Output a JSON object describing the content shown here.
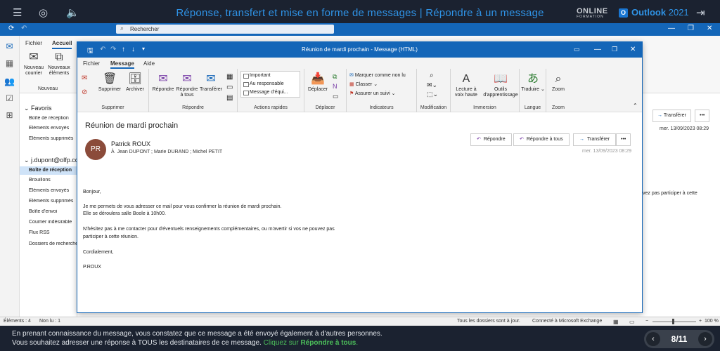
{
  "course": {
    "title": "Réponse, transfert et mise en forme de messages | Répondre à un message",
    "brand_online": "ONLINE",
    "brand_online_sub": "FORMATION",
    "brand_name": "Outlook",
    "brand_version": "2021"
  },
  "outlook": {
    "search_placeholder": "Rechercher",
    "main_tabs": [
      "Fichier",
      "Accueil"
    ],
    "new_mail": "Nouveau courrier",
    "new_items": "Nouveaux éléments",
    "new_group": "Nouveau",
    "folders": {
      "favorites_label": "Favoris",
      "favorites": [
        "Boîte de réception",
        "Éléments envoyés",
        "Éléments supprimés"
      ],
      "account_label": "j.dupont@olfp.co",
      "account_items": [
        "Boîte de réception",
        "Brouillons",
        "Éléments envoyés",
        "Éléments supprimés",
        "Boîte d'envoi",
        "Courrier indésirable",
        "Flux RSS",
        "Dossiers de recherche"
      ]
    },
    "reading": {
      "forward": "Transférer",
      "date": "mer. 13/09/2023 08:29",
      "excerpt": "vez pas participer à cette"
    }
  },
  "message_window": {
    "title": "Réunion de mardi prochain - Message (HTML)",
    "tabs": [
      "Fichier",
      "Message",
      "Aide"
    ],
    "ribbon": {
      "delete_group": "Supprimer",
      "delete_btn": "Supprimer",
      "archive_btn": "Archiver",
      "respond_group": "Répondre",
      "reply_btn": "Répondre",
      "reply_all_btn": "Répondre à tous",
      "forward_btn": "Transférer",
      "quick_steps_group": "Actions rapides",
      "quick_steps": [
        "Important",
        "Au responsable",
        "Message d'équi..."
      ],
      "move_group": "Déplacer",
      "move_btn": "Déplacer",
      "tags_group": "Indicateurs",
      "mark_unread": "Marquer comme non lu",
      "categorize": "Classer",
      "follow_up": "Assurer un suivi",
      "edit_group": "Modification",
      "immersive_group": "Immersion",
      "read_aloud": "Lecture à voix haute",
      "learning_tools": "Outils d'apprentissage",
      "language_group": "Langue",
      "translate": "Traduire",
      "zoom_group": "Zoom",
      "zoom": "Zoom"
    },
    "subject": "Réunion de mardi prochain",
    "sender_initials": "PR",
    "sender": "Patrick ROUX",
    "recipients_prefix": "À",
    "recipients": "Jean DUPONT ; Marie DURAND ; Michel PETIT",
    "date": "mer. 13/09/2023 08:29",
    "actions": {
      "reply": "Répondre",
      "reply_all": "Répondre à tous",
      "forward": "Transférer",
      "more": "•••"
    },
    "body": [
      "Bonjour,",
      "Je me permets de vous adresser ce mail pour vous confirmer la réunion de mardi prochain.",
      "Elle se déroulera salle Boole à 10h00.",
      "N'hésitez pas à me contacter pour d'éventuels renseignements complémentaires, ou m'avertir si vos ne pouvez pas",
      "participer à cette réunion.",
      "Cordialement,",
      "P.ROUX"
    ]
  },
  "status_bar": {
    "items": "Éléments : 4",
    "unread": "Non lu : 1",
    "sync": "Tous les dossiers sont à jour.",
    "connected": "Connecté à Microsoft Exchange",
    "zoom": "100 %"
  },
  "instruction": {
    "line1": "En prenant connaissance du message, vous constatez que ce message a été envoyé également à d'autres personnes.",
    "line2_a": "Vous souhaitez adresser une réponse à TOUS les destinataires de ce message.",
    "line2_b": "Cliquez sur",
    "line2_c": "Répondre à tous",
    "line2_d": ".",
    "page": "8/11"
  }
}
